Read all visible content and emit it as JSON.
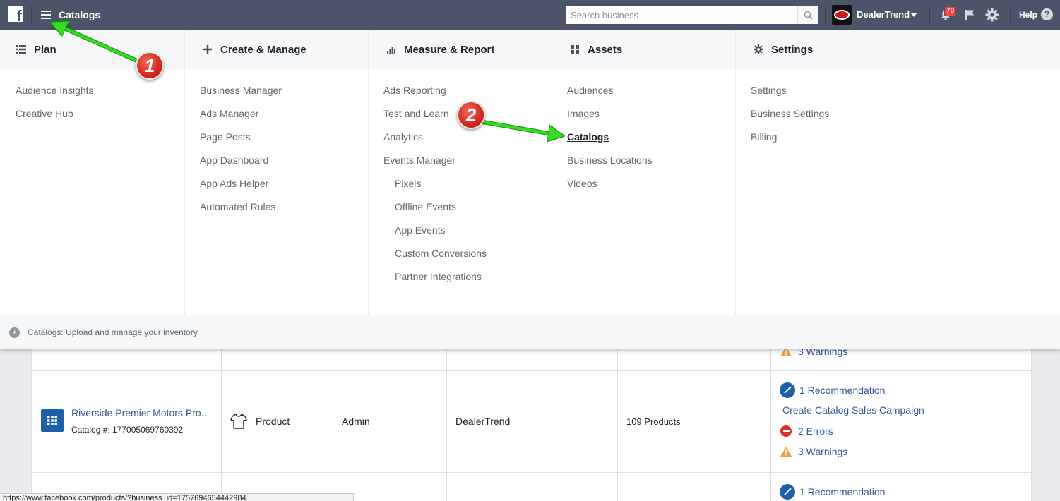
{
  "topbar": {
    "breadcrumb": "Catalogs",
    "search_placeholder": "Search business",
    "account_name": "DealerTrend",
    "notification_count": "70",
    "help_label": "Help",
    "bg_color": "#4b5469"
  },
  "menu": {
    "columns": [
      {
        "heading": "Plan",
        "icon": "list-icon",
        "items": [
          "Audience Insights",
          "Creative Hub"
        ]
      },
      {
        "heading": "Create & Manage",
        "icon": "plus-icon",
        "items": [
          "Business Manager",
          "Ads Manager",
          "Page Posts",
          "App Dashboard",
          "App Ads Helper",
          "Automated Rules"
        ]
      },
      {
        "heading": "Measure & Report",
        "icon": "bar-chart-icon",
        "items": [
          "Ads Reporting",
          "Test and Learn",
          "Analytics",
          "Events Manager",
          "Pixels",
          "Offline Events",
          "App Events",
          "Custom Conversions",
          "Partner Integrations"
        ]
      },
      {
        "heading": "Assets",
        "icon": "grid-icon",
        "items": [
          "Audiences",
          "Images",
          "Catalogs",
          "Business Locations",
          "Videos"
        ]
      },
      {
        "heading": "Settings",
        "icon": "gear-icon",
        "items": [
          "Settings",
          "Business Settings",
          "Billing"
        ]
      }
    ],
    "footer_text": "Catalogs: Upload and manage your inventory."
  },
  "table": {
    "prev_row": {
      "warnings": "3 Warnings"
    },
    "row": {
      "catalog_name": "Riverside Premier Motors Pro...",
      "catalog_number": "Catalog #: 177005069760392",
      "type": "Product",
      "role": "Admin",
      "owner": "DealerTrend",
      "products": "109 Products",
      "recommendation": "1 Recommendation",
      "campaign_link": "Create Catalog Sales Campaign",
      "errors": "2 Errors",
      "warnings": "3 Warnings"
    },
    "next_row": {
      "recommendation": "1 Recommendation"
    }
  },
  "status_bar": {
    "url": "https://www.facebook.com/products/?business_id=1757694654442984"
  },
  "annotations": {
    "badge_1": "1",
    "badge_2": "2",
    "arrow_color": "#33dd22"
  }
}
